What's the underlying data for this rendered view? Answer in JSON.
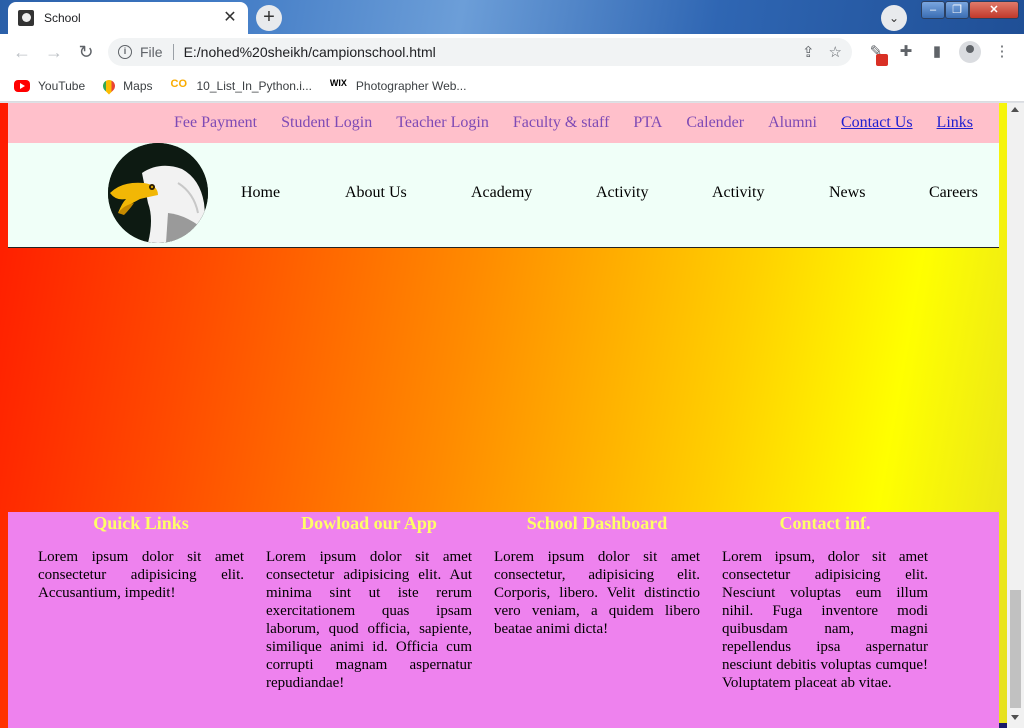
{
  "browser": {
    "tab_title": "School",
    "tab_close": "✕",
    "new_tab": "+",
    "scheme": "File",
    "url": "E:/nohed%20sheikh/campionschool.html",
    "bookmarks": [
      {
        "label": "YouTube",
        "icon": "youtube-icon"
      },
      {
        "label": "Maps",
        "icon": "maps-icon"
      },
      {
        "label": "10_List_In_Python.i...",
        "icon": "colab-icon"
      },
      {
        "label": "Photographer Web...",
        "icon": "wix-icon"
      }
    ]
  },
  "topbar": {
    "links": [
      "Fee Payment",
      "Student Login",
      "Teacher Login",
      "Faculty & staff",
      "PTA",
      "Calender",
      "Alumni",
      "Contact Us",
      "Links"
    ]
  },
  "nav": {
    "items": [
      "Home",
      "About Us",
      "Academy",
      "Activity",
      "Activity",
      "News",
      "Careers"
    ]
  },
  "footer": {
    "columns": [
      {
        "title": "Quick Links",
        "text": "Lorem ipsum dolor sit amet consectetur adipisicing elit. Accusantium, impedit!"
      },
      {
        "title": "Dowload our App",
        "text": "Lorem ipsum dolor sit amet consectetur adipisicing elit. Aut minima sint ut iste rerum exercitationem quas ipsam laborum, quod officia, sapiente, similique animi id. Officia cum corrupti magnam aspernatur repudiandae!"
      },
      {
        "title": "School Dashboard",
        "text": "Lorem ipsum dolor sit amet consectetur, adipisicing elit. Corporis, libero. Velit distinctio vero veniam, a quidem libero beatae animi dicta!"
      },
      {
        "title": "Contact inf.",
        "text": "Lorem ipsum, dolor sit amet consectetur adipisicing elit. Nesciunt voluptas eum illum nihil. Fuga inventore modi quibusdam nam, magni repellendus ipsa aspernatur nesciunt debitis voluptas cumque! Voluptatem placeat ab vitae."
      }
    ]
  },
  "colors": {
    "topbar_bg": "#ffc0cb",
    "nav_bg": "#f0fff8",
    "footer_bg": "#ee82ee",
    "footer_title": "#ffff66"
  }
}
